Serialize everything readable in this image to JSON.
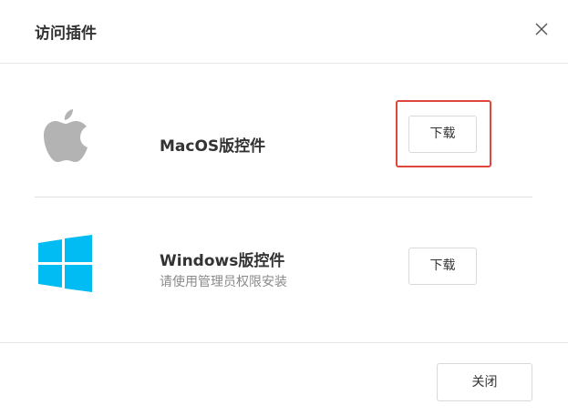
{
  "dialog": {
    "title": "访问插件",
    "close_icon": "close-icon"
  },
  "plugins": [
    {
      "name": "MacOS版控件",
      "icon": "apple-icon",
      "download_label": "下载",
      "highlighted": true,
      "highlight_color": "#e0463c"
    },
    {
      "name": "Windows版控件",
      "subtitle": "请使用管理员权限安装",
      "icon": "windows-icon",
      "icon_color": "#00bcf2",
      "download_label": "下载"
    }
  ],
  "footer": {
    "close_label": "关闭"
  },
  "colors": {
    "apple_logo": "#b3b3b3",
    "windows_logo": "#00bcf2",
    "subtitle_text": "#8a8a8a",
    "highlight": "#e0463c"
  }
}
